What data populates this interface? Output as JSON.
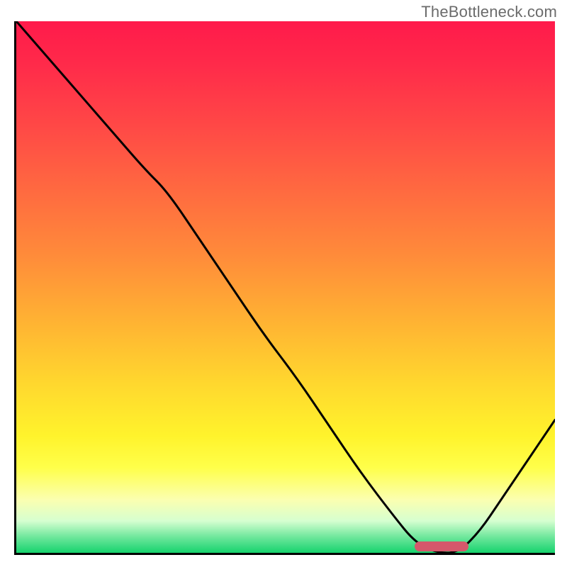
{
  "watermark": "TheBottleneck.com",
  "colors": {
    "curve_stroke": "#000000",
    "marker_fill": "#d5586b",
    "axis": "#000000"
  },
  "chart_data": {
    "type": "line",
    "title": "",
    "xlabel": "",
    "ylabel": "",
    "xlim": [
      0,
      100
    ],
    "ylim": [
      0,
      100
    ],
    "grid": false,
    "legend": false,
    "series": [
      {
        "name": "bottleneck-curve",
        "x": [
          0,
          6,
          12,
          18,
          24,
          28,
          34,
          40,
          46,
          52,
          58,
          64,
          70,
          74,
          78,
          82,
          86,
          90,
          94,
          98,
          100
        ],
        "y": [
          100,
          93,
          86,
          79,
          72,
          68,
          59,
          50,
          41,
          33,
          24,
          15,
          7,
          2,
          0,
          0,
          4,
          10,
          16,
          22,
          25
        ]
      }
    ],
    "annotations": [
      {
        "name": "optimal-range",
        "x_start": 74,
        "x_end": 84,
        "y": 0
      }
    ],
    "background_gradient": {
      "direction": "top-to-bottom",
      "stops": [
        {
          "pct": 0,
          "color": "#ff1a4b"
        },
        {
          "pct": 20,
          "color": "#ff4946"
        },
        {
          "pct": 44,
          "color": "#ff8b3a"
        },
        {
          "pct": 68,
          "color": "#ffd72e"
        },
        {
          "pct": 84,
          "color": "#ffff4a"
        },
        {
          "pct": 94,
          "color": "#d6ffd0"
        },
        {
          "pct": 100,
          "color": "#17d36e"
        }
      ]
    }
  }
}
